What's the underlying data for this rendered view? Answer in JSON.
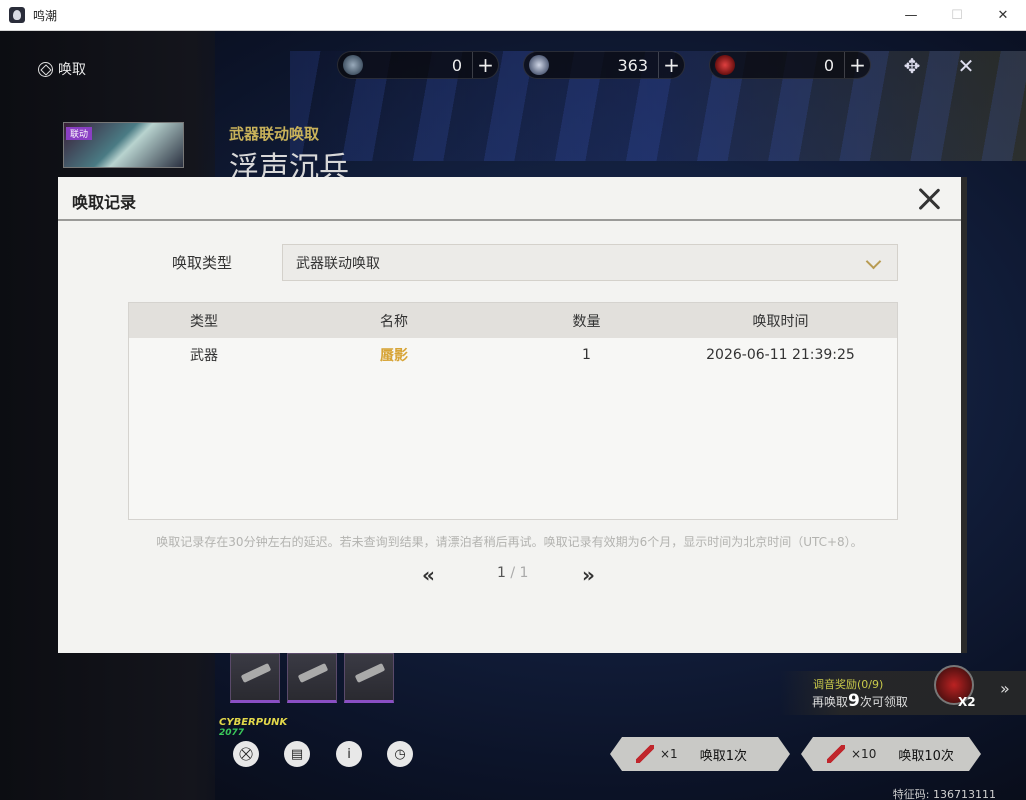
{
  "window": {
    "title": "鸣潮",
    "minimize": "—",
    "maximize": "☐",
    "close": "✕"
  },
  "header": {
    "label": "唤取"
  },
  "currencies": [
    {
      "icon": "lunite-icon",
      "value": "0"
    },
    {
      "icon": "astrite-icon",
      "value": "363"
    },
    {
      "icon": "forging-tide-icon",
      "value": "0"
    }
  ],
  "banner": {
    "thumb_tag": "联动",
    "subtitle": "武器联动唤取",
    "title": "浮声沉兵"
  },
  "modal": {
    "title": "唤取记录",
    "type_label": "唤取类型",
    "type_value": "武器联动唤取",
    "columns": [
      "类型",
      "名称",
      "数量",
      "唤取时间"
    ],
    "rows": [
      {
        "type": "武器",
        "name": "蜃影",
        "count": "1",
        "time": "2026-06-11 21:39:25"
      }
    ],
    "notice": "唤取记录存在30分钟左右的延迟。若未查询到结果，请漂泊者稍后再试。唤取记录有效期为6个月，显示时间为北京时间（UTC+8）。",
    "pager": {
      "current": "1",
      "separator": " / ",
      "total": "1",
      "prev": "«",
      "next": "»"
    }
  },
  "reward": {
    "line1": "调音奖励(0/9)",
    "line2_prefix": "再唤取",
    "line2_num": "9",
    "line2_suffix": "次可领取",
    "multiplier": "X2"
  },
  "cyberpunk": {
    "line1": "CYBERPUNK",
    "line2": "2077"
  },
  "bottom_buttons": {
    "shop": "⛒",
    "record": "▤",
    "info": "i",
    "history": "◷"
  },
  "pull": {
    "single": {
      "count": "×1",
      "label": "唤取1次"
    },
    "ten": {
      "count": "×10",
      "label": "唤取10次"
    }
  },
  "footer": {
    "id_text": "特征码: 136713111"
  },
  "colors": {
    "accent_gold": "#d7a436",
    "chevron": "#b89b52",
    "banner_sub": "#c9b25a"
  }
}
